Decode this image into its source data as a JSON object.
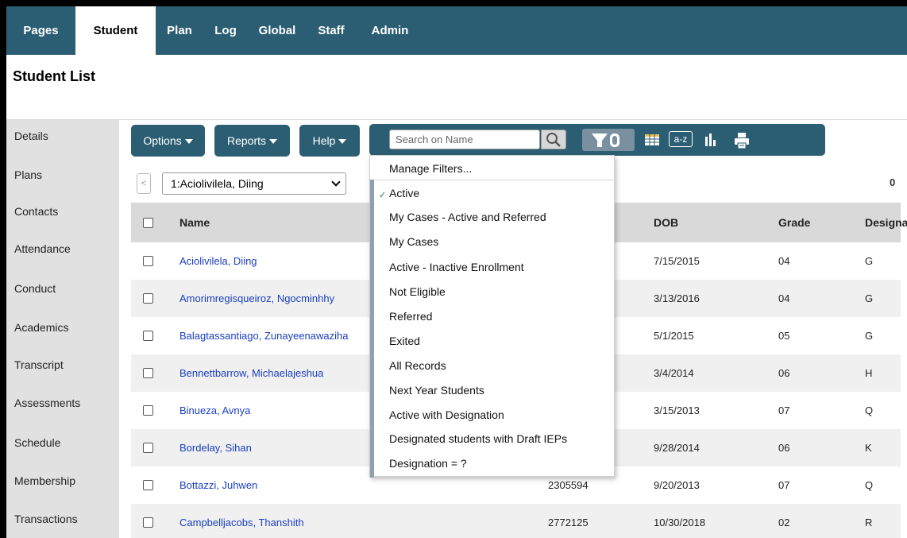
{
  "nav": {
    "tabs": [
      "Pages",
      "Student",
      "Plan",
      "Log",
      "Global",
      "Staff",
      "Admin"
    ],
    "active": "Student"
  },
  "page_title": "Student List",
  "sidebar": {
    "items": [
      "Details",
      "Plans",
      "Contacts",
      "Attendance",
      "Conduct",
      "Academics",
      "Transcript",
      "Assessments",
      "Schedule",
      "Membership",
      "Transactions"
    ]
  },
  "toolbar": {
    "options_label": "Options",
    "reports_label": "Reports",
    "help_label": "Help",
    "search_placeholder": "Search on Name",
    "icons": [
      "search-icon",
      "filter-icon",
      "grid-icon",
      "sort-az-icon",
      "chart-icon",
      "print-icon"
    ],
    "sort_label": "a-z"
  },
  "pager": {
    "prev_label": "<",
    "selected_student": "1:Aciolivilela, Diing",
    "count_text": "0"
  },
  "table": {
    "headers": {
      "name": "Name",
      "dob": "DOB",
      "grade": "Grade",
      "designation": "Designa"
    },
    "rows": [
      {
        "name": "Aciolivilela, Diing",
        "id": "",
        "dob": "7/15/2015",
        "grade": "04",
        "designation": "G"
      },
      {
        "name": "Amorimregisqueiroz, Ngocminhhy",
        "id": "",
        "dob": "3/13/2016",
        "grade": "04",
        "designation": "G"
      },
      {
        "name": "Balagtassantiago, Zunayeenawaziha",
        "id": "",
        "dob": "5/1/2015",
        "grade": "05",
        "designation": "G"
      },
      {
        "name": "Bennettbarrow, Michaelajeshua",
        "id": "",
        "dob": "3/4/2014",
        "grade": "06",
        "designation": "H"
      },
      {
        "name": "Binueza, Avnya",
        "id": "",
        "dob": "3/15/2013",
        "grade": "07",
        "designation": "Q"
      },
      {
        "name": "Bordelay, Sihan",
        "id": "",
        "dob": "9/28/2014",
        "grade": "06",
        "designation": "K"
      },
      {
        "name": "Bottazzi, Juhwen",
        "id": "2305594",
        "dob": "9/20/2013",
        "grade": "07",
        "designation": "Q"
      },
      {
        "name": "Campbelljacobs, Thanshith",
        "id": "2772125",
        "dob": "10/30/2018",
        "grade": "02",
        "designation": "R"
      }
    ]
  },
  "filter_menu": {
    "manage_label": "Manage Filters...",
    "items": [
      "Active",
      "My Cases - Active and Referred",
      "My Cases",
      "Active - Inactive Enrollment",
      "Not Eligible",
      "Referred",
      "Exited",
      "All Records",
      "Next Year Students",
      "Active with Designation",
      "Designated students with Draft IEPs",
      "Designation = ?"
    ],
    "checked": "Active",
    "check_mark": "✓"
  },
  "colors": {
    "nav": "#2c5e73",
    "link": "#1a3fbf",
    "sidebar": "#e1e1e1"
  }
}
